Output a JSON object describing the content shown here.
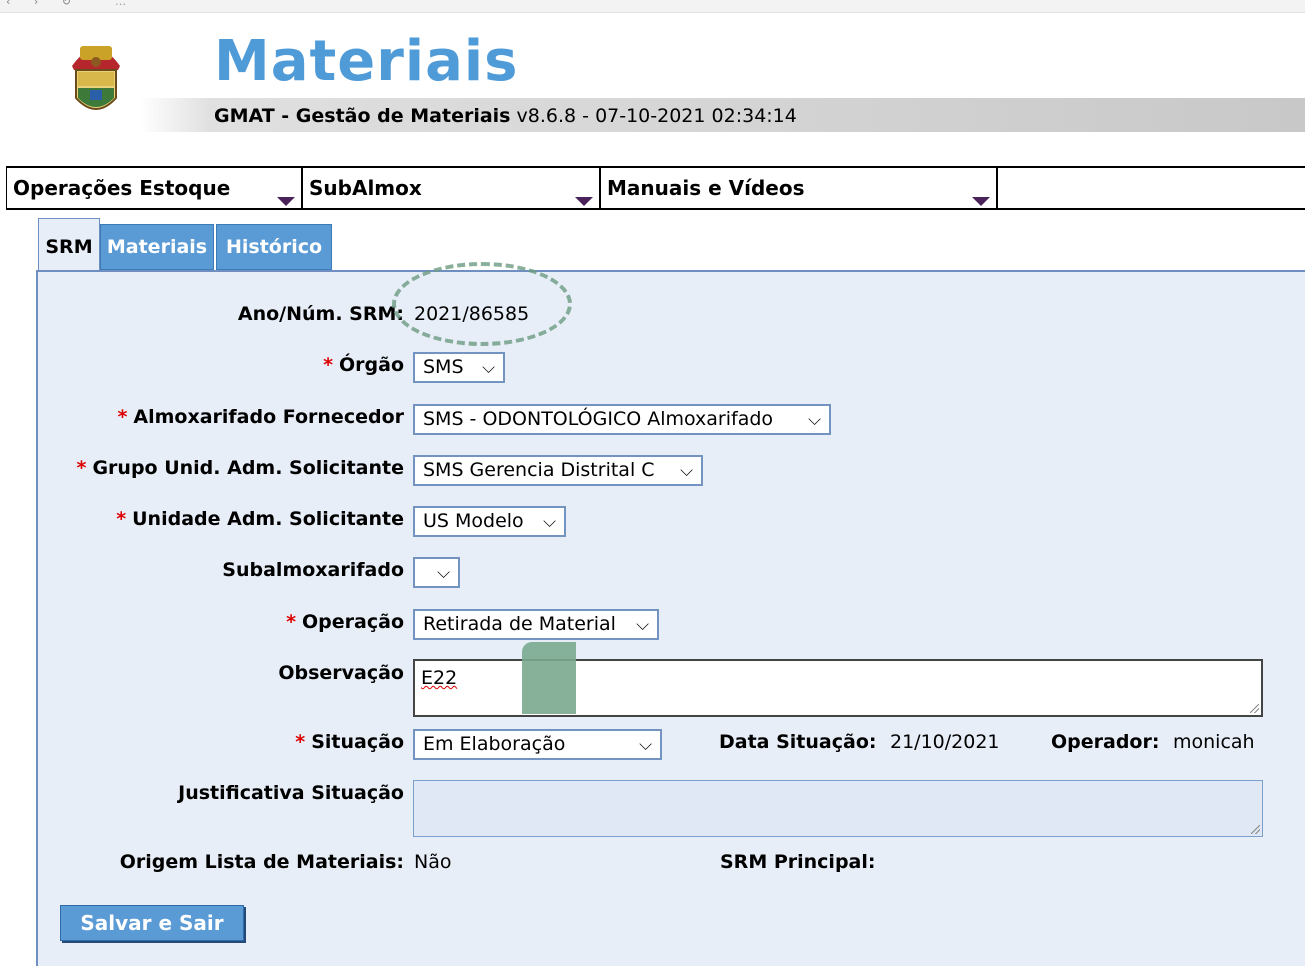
{
  "browser": {
    "url": "…"
  },
  "header": {
    "app_title": "Materiais",
    "subtitle_bold": "GMAT - Gestão de Materiais",
    "subtitle_version": " v8.6.8 - 07-10-2021 02:34:14"
  },
  "menu": {
    "items": [
      {
        "label": "Operações Estoque"
      },
      {
        "label": "SubAlmox"
      },
      {
        "label": "Manuais e Vídeos"
      }
    ]
  },
  "tabs": [
    {
      "label": "SRM",
      "active": true
    },
    {
      "label": "Materiais",
      "active": false
    },
    {
      "label": "Histórico",
      "active": false
    }
  ],
  "form": {
    "required_marker": "*",
    "ano_num": {
      "label": "Ano/Núm. SRM:",
      "value": "2021/86585"
    },
    "orgao": {
      "label": "Órgão",
      "value": "SMS"
    },
    "almox": {
      "label": "Almoxarifado Fornecedor",
      "value": "SMS - ODONTOLÓGICO Almoxarifado"
    },
    "grupo": {
      "label": "Grupo Unid. Adm. Solicitante",
      "value": "SMS Gerencia Distrital C"
    },
    "unidade": {
      "label": "Unidade Adm. Solicitante",
      "value": "US Modelo"
    },
    "subalmox": {
      "label": "Subalmoxarifado",
      "value": ""
    },
    "operacao": {
      "label": "Operação",
      "value": "Retirada de Material"
    },
    "observacao": {
      "label": "Observação",
      "value": "E22"
    },
    "situacao": {
      "label": "Situação",
      "value": "Em Elaboração"
    },
    "data_situacao": {
      "label": "Data Situação:",
      "value": "21/10/2021"
    },
    "operador": {
      "label": "Operador:",
      "value": "monicah"
    },
    "justificativa": {
      "label": "Justificativa Situação",
      "value": ""
    },
    "origem": {
      "label": "Origem Lista de Materiais:",
      "value": "Não"
    },
    "srm_principal": {
      "label": "SRM Principal:",
      "value": ""
    }
  },
  "buttons": {
    "salvar": "Salvar e Sair"
  },
  "icons": {
    "dropdown": "chevron-down-icon",
    "menu_caret": "caret-down-icon",
    "logo": "coat-of-arms-logo"
  },
  "colors": {
    "accent": "#4f9bd8",
    "tab_blue": "#5b9bd5",
    "panel": "#e8eef7",
    "required": "#d00000"
  }
}
